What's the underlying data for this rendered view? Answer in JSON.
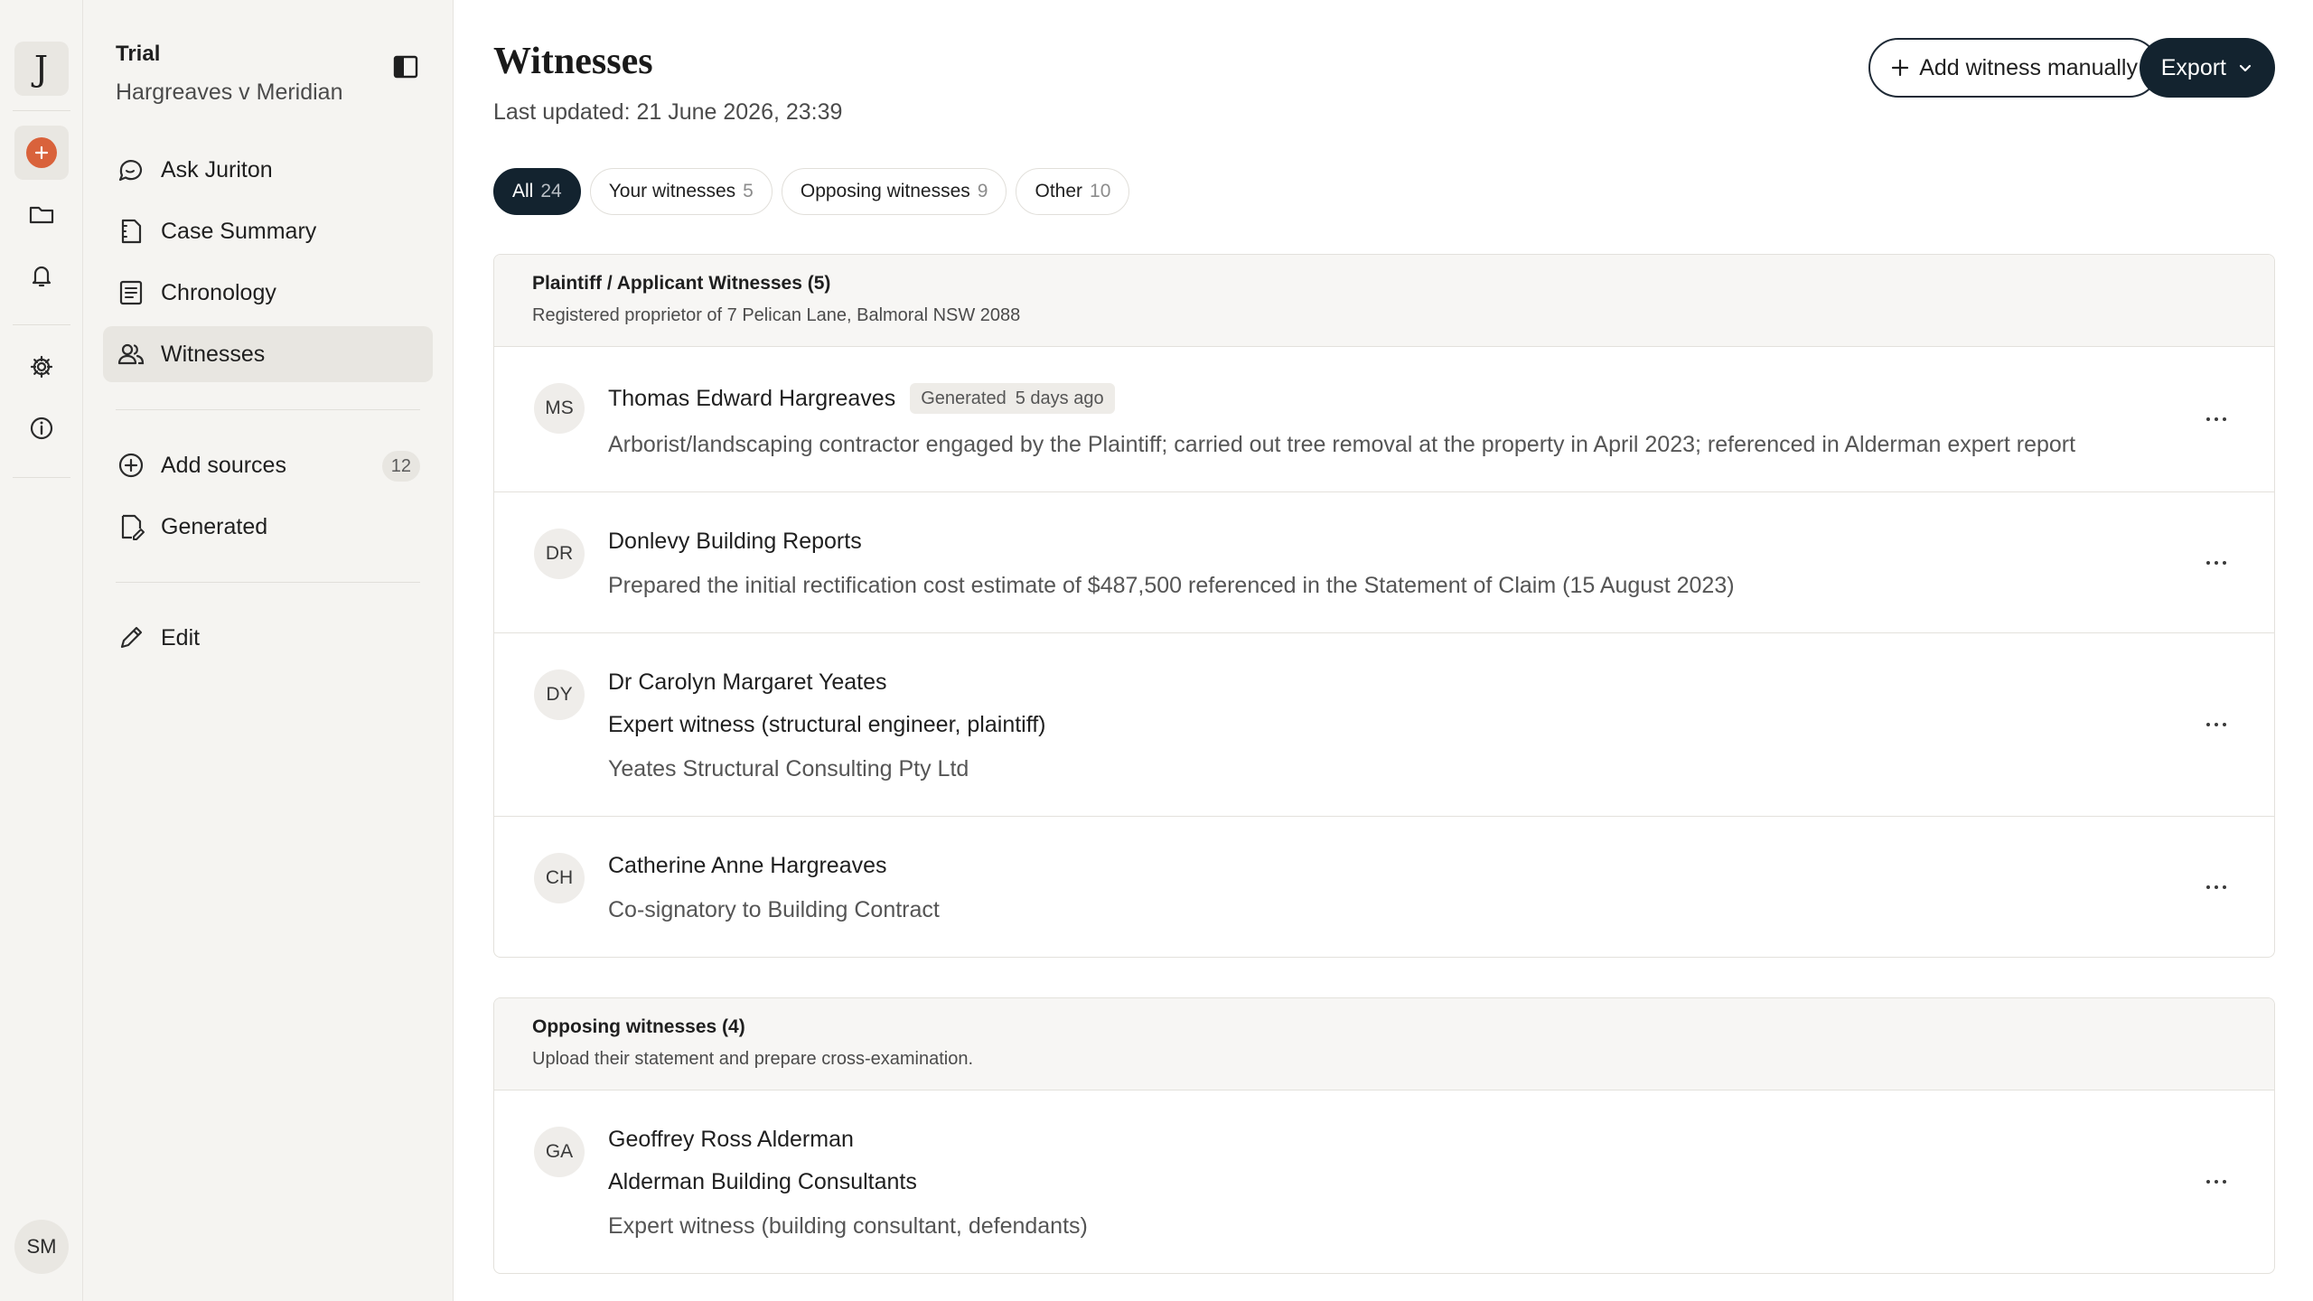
{
  "rail": {
    "logo": "J",
    "avatar": "SM"
  },
  "case": {
    "type": "Trial",
    "name": "Hargreaves v Meridian"
  },
  "nav": {
    "primary": [
      {
        "label": "Ask Juriton",
        "icon": "chat-bubble-icon"
      },
      {
        "label": "Case Summary",
        "icon": "document-icon"
      },
      {
        "label": "Chronology",
        "icon": "list-icon"
      },
      {
        "label": "Witnesses",
        "icon": "people-icon",
        "active": true
      }
    ],
    "secondary": [
      {
        "label": "Add sources",
        "icon": "plus-circle-icon",
        "count": "12"
      },
      {
        "label": "Generated",
        "icon": "generated-file-icon"
      }
    ],
    "tertiary": [
      {
        "label": "Edit",
        "icon": "pencil-icon"
      }
    ]
  },
  "page": {
    "title": "Witnesses",
    "updated": "Last updated: 21 June 2026, 23:39",
    "add_button": "Add witness manually",
    "export_button": "Export"
  },
  "tabs": [
    {
      "label": "All",
      "count": "24",
      "active": true
    },
    {
      "label": "Your witnesses",
      "count": "5"
    },
    {
      "label": "Opposing witnesses",
      "count": "9"
    },
    {
      "label": "Other",
      "count": "10"
    }
  ],
  "sections": [
    {
      "title": "Plaintiff / Applicant Witnesses (5)",
      "subtitle": "Registered proprietor of 7 Pelican Lane, Balmoral NSW 2088",
      "rows": [
        {
          "initials": "MS",
          "name": "Thomas Edward Hargreaves",
          "badge": "Generated",
          "badge_time": "5 days ago",
          "desc": "Arborist/landscaping contractor engaged by the Plaintiff; carried out tree removal at the property in April 2023; referenced in Alderman expert report"
        },
        {
          "initials": "DR",
          "name": "Donlevy Building Reports",
          "desc": "Prepared the initial rectification cost estimate of $487,500 referenced in the Statement of Claim (15 August 2023)"
        },
        {
          "initials": "DY",
          "name": "Dr Carolyn Margaret Yeates",
          "line2": "Expert witness (structural engineer, plaintiff)",
          "desc": "Yeates Structural Consulting Pty Ltd"
        },
        {
          "initials": "CH",
          "name": "Catherine Anne Hargreaves",
          "desc": "Co-signatory to Building Contract"
        }
      ]
    },
    {
      "title": "Opposing witnesses (4)",
      "subtitle": "Upload their statement and prepare cross-examination.",
      "rows": [
        {
          "initials": "GA",
          "name": "Geoffrey Ross Alderman",
          "line2": "Alderman Building Consultants",
          "desc": "Expert witness (building consultant, defendants)"
        }
      ]
    }
  ],
  "colors": {
    "accent_dark": "#13232f",
    "new_button": "#d9623b",
    "sidebar_bg": "#f5f4f1"
  }
}
